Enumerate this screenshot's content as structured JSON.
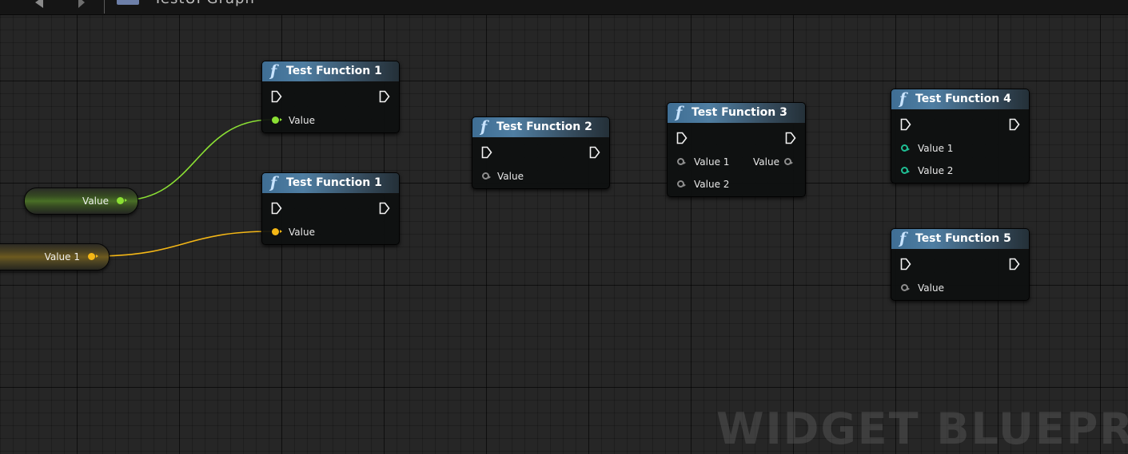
{
  "toolbar": {
    "back_icon": "triangle-left-icon",
    "forward_icon": "chevron-right-icon",
    "tab_title": "TestUI    Graph"
  },
  "colors": {
    "wire_green": "#8be034",
    "wire_yellow": "#f4b716",
    "pin_teal": "#1fbf94",
    "pin_gray": "#8d8d8d",
    "header_blue": "#4f7ea2"
  },
  "variables": [
    {
      "label": "Value",
      "pin": "green"
    },
    {
      "label": "Value 1",
      "pin": "yellow"
    }
  ],
  "nodes": [
    {
      "title": "Test Function 1",
      "pins": [
        {
          "label": "Value",
          "type": "green",
          "connected": true
        }
      ]
    },
    {
      "title": "Test Function 1",
      "pins": [
        {
          "label": "Value",
          "type": "yellow",
          "connected": true
        }
      ]
    },
    {
      "title": "Test Function 2",
      "pins": [
        {
          "label": "Value",
          "type": "gray"
        }
      ]
    },
    {
      "title": "Test Function 3",
      "pins": [
        {
          "label": "Value 1",
          "type": "gray"
        },
        {
          "label": "Value 2",
          "type": "gray"
        }
      ],
      "outputs": [
        {
          "label": "Value",
          "type": "gray"
        }
      ]
    },
    {
      "title": "Test Function 4",
      "pins": [
        {
          "label": "Value 1",
          "type": "teal"
        },
        {
          "label": "Value 2",
          "type": "teal"
        }
      ]
    },
    {
      "title": "Test Function 5",
      "pins": [
        {
          "label": "Value",
          "type": "gray"
        }
      ]
    }
  ],
  "watermark": "WIDGET BLUEPRINT"
}
